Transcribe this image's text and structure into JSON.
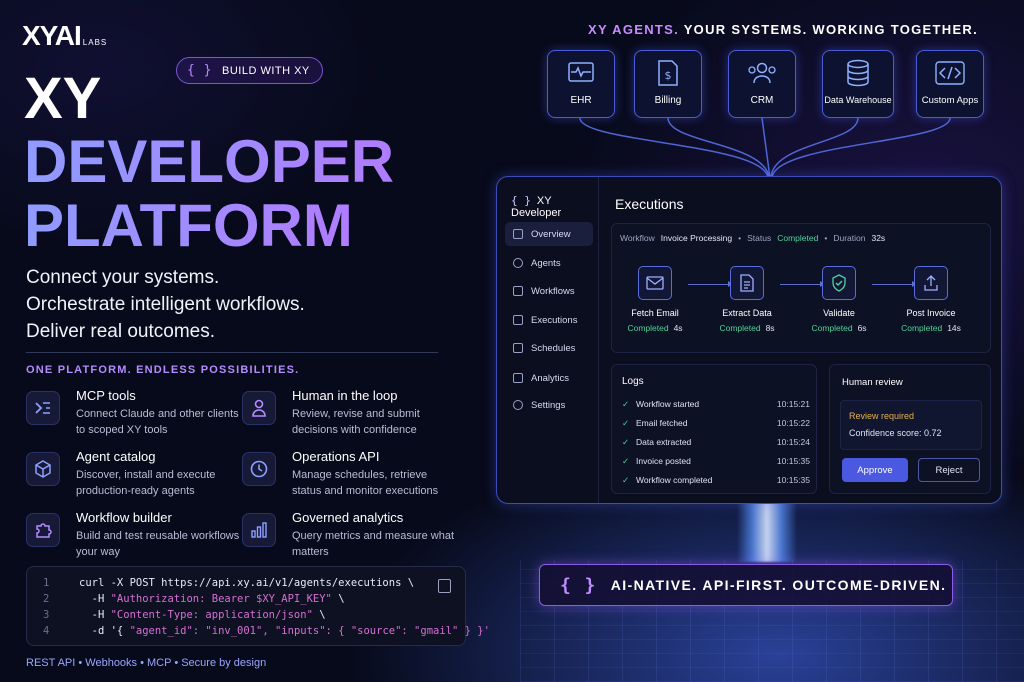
{
  "brand": {
    "logo": "XYAI",
    "sub": "LABS"
  },
  "build_badge": {
    "icon": "{ }",
    "label": "BUILD WITH XY"
  },
  "hero": {
    "line1": "XY",
    "line2": "DEVELOPER",
    "line3": "PLATFORM"
  },
  "taglines": [
    "Connect your systems.",
    "Orchestrate intelligent workflows.",
    "Deliver real outcomes."
  ],
  "section_title": "ONE PLATFORM. ENDLESS POSSIBILITIES.",
  "features": [
    {
      "icon": "terminal-icon",
      "title": "MCP tools",
      "desc": "Connect Claude and other clients to scoped XY tools"
    },
    {
      "icon": "person-icon",
      "title": "Human in the loop",
      "desc": "Review, revise and submit decisions with confidence"
    },
    {
      "icon": "cube-icon",
      "title": "Agent catalog",
      "desc": "Discover, install and execute production-ready agents"
    },
    {
      "icon": "clock-icon",
      "title": "Operations API",
      "desc": "Manage schedules, retrieve status and monitor executions"
    },
    {
      "icon": "puzzle-icon",
      "title": "Workflow builder",
      "desc": "Build and test reusable workflows your way"
    },
    {
      "icon": "bar-chart-icon",
      "title": "Governed analytics",
      "desc": "Query metrics and measure what matters"
    }
  ],
  "code": {
    "lines": [
      {
        "n": "1",
        "pre": "curl -X POST https://api.xy.ai/v1/agents/executions \\",
        "str": "",
        "post": ""
      },
      {
        "n": "2",
        "pre": "  -H ",
        "str": "\"Authorization: Bearer $XY_API_KEY\"",
        "post": " \\"
      },
      {
        "n": "3",
        "pre": "  -H ",
        "str": "\"Content-Type: application/json\"",
        "post": " \\"
      },
      {
        "n": "4",
        "pre": "  -d '{ ",
        "str": "\"agent_id\": \"inv_001\", \"inputs\": { \"source\": \"gmail\" } }'",
        "post": ""
      }
    ]
  },
  "footer": "REST API  •  Webhooks  •  MCP  •  Secure by design",
  "right_tagline": {
    "a": "XY AGENTS.",
    "b": " YOUR SYSTEMS. WORKING TOGETHER."
  },
  "systems": [
    {
      "icon": "heart-monitor-icon",
      "label": "EHR"
    },
    {
      "icon": "invoice-icon",
      "label": "Billing"
    },
    {
      "icon": "users-icon",
      "label": "CRM"
    },
    {
      "icon": "database-icon",
      "label": "Data Warehouse"
    },
    {
      "icon": "code-icon",
      "label": "Custom Apps"
    }
  ],
  "app": {
    "brand": "XY Developer",
    "brand_icon": "{ }",
    "nav": [
      {
        "icon": "home-icon",
        "label": "Overview"
      },
      {
        "icon": "agent-icon",
        "label": "Agents"
      },
      {
        "icon": "workflow-icon",
        "label": "Workflows"
      },
      {
        "icon": "play-icon",
        "label": "Executions"
      },
      {
        "icon": "calendar-icon",
        "label": "Schedules"
      },
      {
        "icon": "analytics-icon",
        "label": "Analytics"
      },
      {
        "icon": "gear-icon",
        "label": "Settings"
      }
    ],
    "title": "Executions",
    "meta": {
      "workflow_label": "Workflow",
      "workflow": "Invoice Processing",
      "status_label": "Status",
      "status": "Completed",
      "duration_label": "Duration",
      "duration": "32s"
    },
    "steps": [
      {
        "icon": "mail-icon",
        "name": "Fetch Email",
        "status": "Completed",
        "time": "4s"
      },
      {
        "icon": "document-icon",
        "name": "Extract Data",
        "status": "Completed",
        "time": "8s"
      },
      {
        "icon": "shield-check-icon",
        "name": "Validate",
        "status": "Completed",
        "time": "6s"
      },
      {
        "icon": "upload-icon",
        "name": "Post Invoice",
        "status": "Completed",
        "time": "14s"
      }
    ],
    "logs_title": "Logs",
    "logs": [
      {
        "msg": "Workflow started",
        "time": "10:15:21"
      },
      {
        "msg": "Email fetched",
        "time": "10:15:22"
      },
      {
        "msg": "Data extracted",
        "time": "10:15:24"
      },
      {
        "msg": "Invoice posted",
        "time": "10:15:35"
      },
      {
        "msg": "Workflow completed",
        "time": "10:15:35"
      }
    ],
    "review": {
      "title": "Human review",
      "required": "Review required",
      "confidence": "Confidence score: 0.72",
      "approve": "Approve",
      "reject": "Reject"
    }
  },
  "banner": {
    "icon": "{ }",
    "text": "AI-NATIVE. API-FIRST. OUTCOME-DRIVEN."
  },
  "colors": {
    "accent": "#b07cff",
    "success": "#4fd39a",
    "warning": "#e3b04b",
    "primary": "#4b58e0"
  }
}
